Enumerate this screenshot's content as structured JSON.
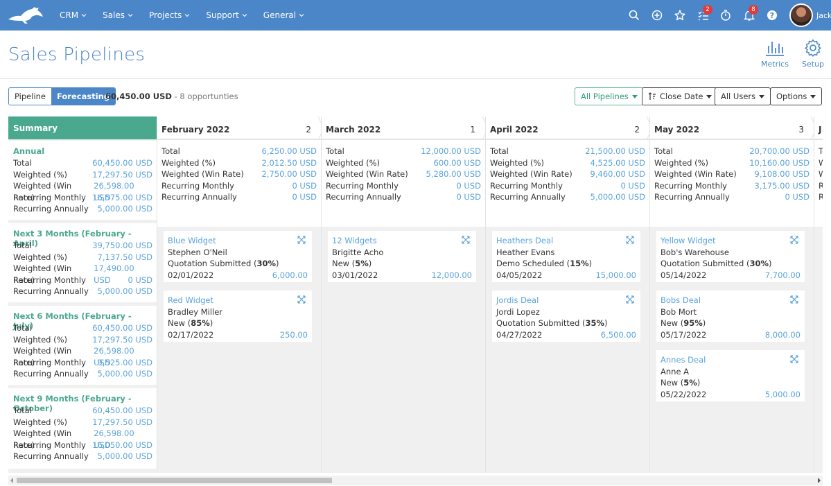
{
  "nav": {
    "items": [
      {
        "label": "CRM"
      },
      {
        "label": "Sales"
      },
      {
        "label": "Projects"
      },
      {
        "label": "Support"
      },
      {
        "label": "General"
      }
    ],
    "icons": [
      "search-icon",
      "plus-circle-icon",
      "star-icon",
      "tasks-icon",
      "timer-icon",
      "bell-icon",
      "help-icon"
    ],
    "tasks_badge": "2",
    "notifications_badge": "8",
    "user_name": "Jack"
  },
  "page": {
    "title": "Sales Pipelines",
    "metrics_label": "Metrics",
    "setup_label": "Setup"
  },
  "toolbar": {
    "pipeline_tab": "Pipeline",
    "forecasting_tab": "Forecasting",
    "total_amount": "60,450.00 USD",
    "opportunities": "- 8 opportunties",
    "all_pipelines": "All Pipelines",
    "close_date": "Close Date",
    "all_users": "All Users",
    "options": "Options"
  },
  "summary": {
    "title": "Summary",
    "groups": [
      {
        "title": "Annual",
        "rows": [
          {
            "label": "Total",
            "value": "60,450.00 USD"
          },
          {
            "label": "Weighted (%)",
            "value": "17,297.50 USD"
          },
          {
            "label": "Weighted (Win Rate)",
            "value": "26,598.00 USD"
          },
          {
            "label": "Recurring Monthly",
            "value": "16,575.00 USD"
          },
          {
            "label": "Recurring Annually",
            "value": "5,000.00 USD"
          }
        ]
      },
      {
        "title": "Next 3 Months (February - April)",
        "rows": [
          {
            "label": "Total",
            "value": "39,750.00 USD"
          },
          {
            "label": "Weighted (%)",
            "value": "7,137.50 USD"
          },
          {
            "label": "Weighted (Win Rate)",
            "value": "17,490.00 USD"
          },
          {
            "label": "Recurring Monthly",
            "value": "0 USD"
          },
          {
            "label": "Recurring Annually",
            "value": "5,000.00 USD"
          }
        ]
      },
      {
        "title": "Next 6 Months (February - July)",
        "rows": [
          {
            "label": "Total",
            "value": "60,450.00 USD"
          },
          {
            "label": "Weighted (%)",
            "value": "17,297.50 USD"
          },
          {
            "label": "Weighted (Win Rate)",
            "value": "26,598.00 USD"
          },
          {
            "label": "Recurring Monthly",
            "value": "9,525.00 USD"
          },
          {
            "label": "Recurring Annually",
            "value": "5,000.00 USD"
          }
        ]
      },
      {
        "title": "Next 9 Months (February - October)",
        "rows": [
          {
            "label": "Total",
            "value": "60,450.00 USD"
          },
          {
            "label": "Weighted (%)",
            "value": "17,297.50 USD"
          },
          {
            "label": "Weighted (Win Rate)",
            "value": "26,598.00 USD"
          },
          {
            "label": "Recurring Monthly",
            "value": "16,050.00 USD"
          },
          {
            "label": "Recurring Annually",
            "value": "5,000.00 USD"
          }
        ]
      }
    ]
  },
  "columns": [
    {
      "month": "February 2022",
      "count": "2",
      "stats": [
        {
          "label": "Total",
          "value": "6,250.00 USD"
        },
        {
          "label": "Weighted (%)",
          "value": "2,012.50 USD"
        },
        {
          "label": "Weighted (Win Rate)",
          "value": "2,750.00 USD"
        },
        {
          "label": "Recurring Monthly",
          "value": "0 USD"
        },
        {
          "label": "Recurring Annually",
          "value": "0 USD"
        }
      ],
      "cards": [
        {
          "name": "Blue Widget",
          "contact": "Stephen O'Neil",
          "stage": "Quotation Submitted",
          "pct": "30%",
          "date": "02/01/2022",
          "amount": "6,000.00"
        },
        {
          "name": "Red Widget",
          "contact": "Bradley Miller",
          "stage": "New",
          "pct": "85%",
          "date": "02/17/2022",
          "amount": "250.00"
        }
      ]
    },
    {
      "month": "March 2022",
      "count": "1",
      "stats": [
        {
          "label": "Total",
          "value": "12,000.00 USD"
        },
        {
          "label": "Weighted (%)",
          "value": "600.00 USD"
        },
        {
          "label": "Weighted (Win Rate)",
          "value": "5,280.00 USD"
        },
        {
          "label": "Recurring Monthly",
          "value": "0 USD"
        },
        {
          "label": "Recurring Annually",
          "value": "0 USD"
        }
      ],
      "cards": [
        {
          "name": "12 Widgets",
          "contact": "Brigitte Acho",
          "stage": "New",
          "pct": "5%",
          "date": "03/01/2022",
          "amount": "12,000.00"
        }
      ]
    },
    {
      "month": "April 2022",
      "count": "2",
      "stats": [
        {
          "label": "Total",
          "value": "21,500.00 USD"
        },
        {
          "label": "Weighted (%)",
          "value": "4,525.00 USD"
        },
        {
          "label": "Weighted (Win Rate)",
          "value": "9,460.00 USD"
        },
        {
          "label": "Recurring Monthly",
          "value": "0 USD"
        },
        {
          "label": "Recurring Annually",
          "value": "5,000.00 USD"
        }
      ],
      "cards": [
        {
          "name": "Heathers Deal",
          "contact": "Heather Evans",
          "stage": "Demo Scheduled",
          "pct": "15%",
          "date": "04/05/2022",
          "amount": "15,000.00"
        },
        {
          "name": "Jordis Deal",
          "contact": "Jordi Lopez",
          "stage": "Quotation Submitted",
          "pct": "35%",
          "date": "04/27/2022",
          "amount": "6,500.00"
        }
      ]
    },
    {
      "month": "May 2022",
      "count": "3",
      "stats": [
        {
          "label": "Total",
          "value": "20,700.00 USD"
        },
        {
          "label": "Weighted (%)",
          "value": "10,160.00 USD"
        },
        {
          "label": "Weighted (Win Rate)",
          "value": "9,108.00 USD"
        },
        {
          "label": "Recurring Monthly",
          "value": "3,175.00 USD"
        },
        {
          "label": "Recurring Annually",
          "value": "0 USD"
        }
      ],
      "cards": [
        {
          "name": "Yellow Widget",
          "contact": "Bob's Warehouse",
          "stage": "Quotation Submitted",
          "pct": "30%",
          "date": "05/14/2022",
          "amount": "7,700.00"
        },
        {
          "name": "Bobs Deal",
          "contact": "Bob Mort",
          "stage": "New",
          "pct": "95%",
          "date": "05/17/2022",
          "amount": "8,000.00"
        },
        {
          "name": "Annes Deal",
          "contact": "Anne A",
          "stage": "New",
          "pct": "5%",
          "date": "05/22/2022",
          "amount": "5,000.00"
        }
      ]
    }
  ],
  "next_column_stub": {
    "month": "J",
    "labels": [
      "To",
      "W",
      "W",
      "R",
      "R"
    ]
  },
  "colors": {
    "brand": "#4a86c8",
    "accent_green": "#4aa88f",
    "link": "#5aa3dc",
    "badge": "#e23b3b"
  }
}
